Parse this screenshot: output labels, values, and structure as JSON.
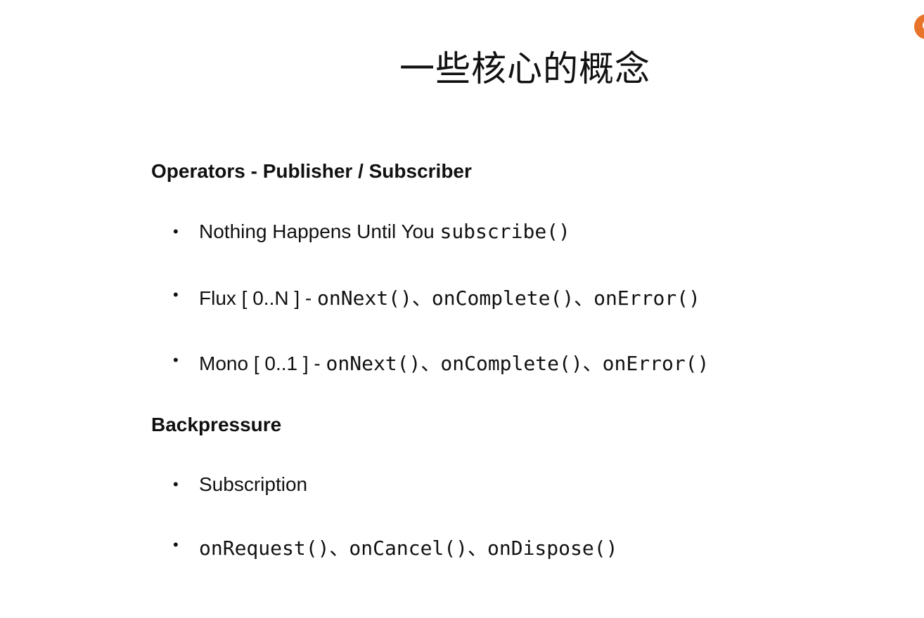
{
  "slide": {
    "title": "一些核心的概念"
  },
  "sections": [
    {
      "heading": "Operators - Publisher / Subscriber",
      "items": [
        {
          "plain": "Nothing Happens Until You ",
          "code": "subscribe()"
        },
        {
          "plain": "Flux [ 0..N ] - ",
          "code": "onNext()、onComplete()、onError()"
        },
        {
          "plain": "Mono [ 0..1 ] - ",
          "code": "onNext()、onComplete()、onError()"
        }
      ]
    },
    {
      "heading": "Backpressure",
      "items": [
        {
          "plain": "Subscription",
          "code": ""
        },
        {
          "plain": "",
          "code": "onRequest()、onCancel()、onDispose()"
        }
      ]
    }
  ],
  "logo": {
    "icon": "orange-logo-icon",
    "color": "#e8732a"
  },
  "bullet_char": "•"
}
